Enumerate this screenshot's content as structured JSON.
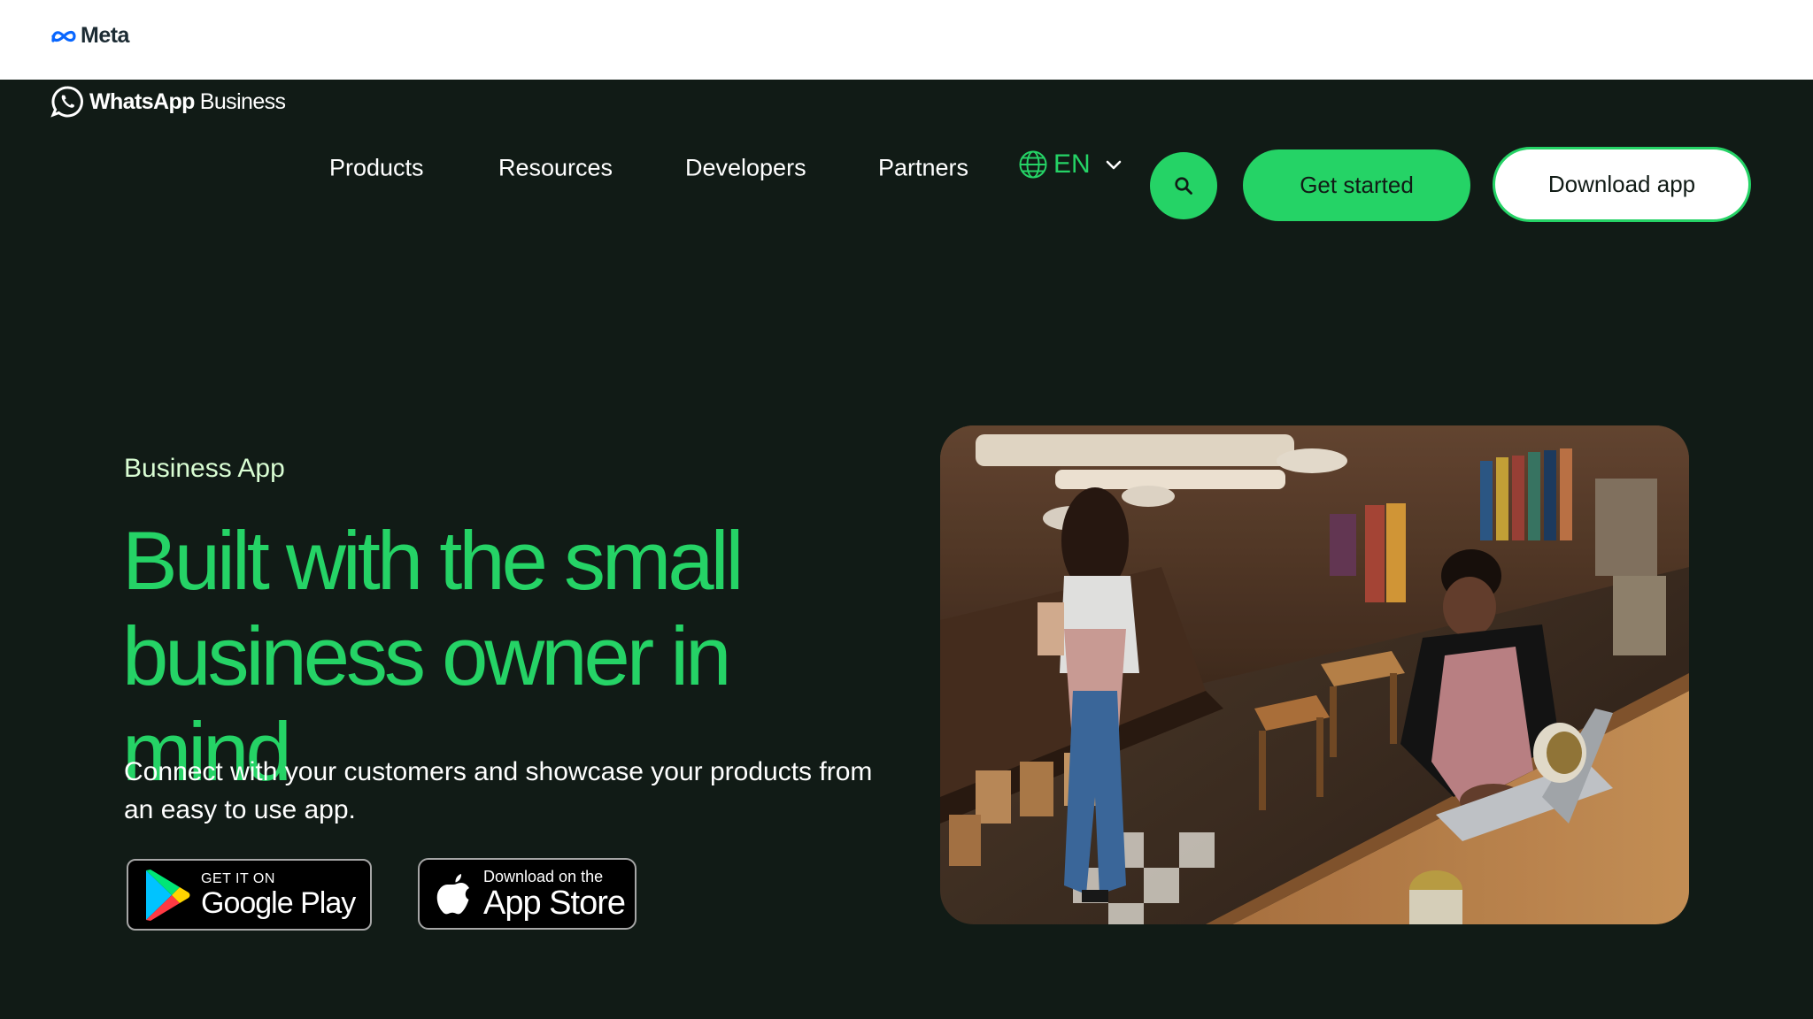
{
  "meta_bar": {
    "brand": "Meta"
  },
  "header": {
    "logo_bold": "WhatsApp",
    "logo_light": "Business",
    "nav": [
      "Products",
      "Resources",
      "Developers",
      "Partners"
    ],
    "language": "EN",
    "get_started": "Get started",
    "download_app": "Download app"
  },
  "hero": {
    "eyebrow": "Business App",
    "headline_line1": "Built with the small",
    "headline_line2": "business owner in mind",
    "subtext": "Connect with your customers and showcase your products from an easy to use app.",
    "google_play": {
      "small": "GET IT ON",
      "big": "Google Play"
    },
    "app_store": {
      "small": "Download on the",
      "big": "App Store"
    }
  },
  "colors": {
    "background": "#111b16",
    "accent": "#25d366",
    "eyebrow": "#d9fdd3"
  },
  "icons": [
    "meta-logo-icon",
    "whatsapp-logo-icon",
    "globe-icon",
    "chevron-down-icon",
    "search-icon",
    "google-play-icon",
    "apple-icon"
  ]
}
